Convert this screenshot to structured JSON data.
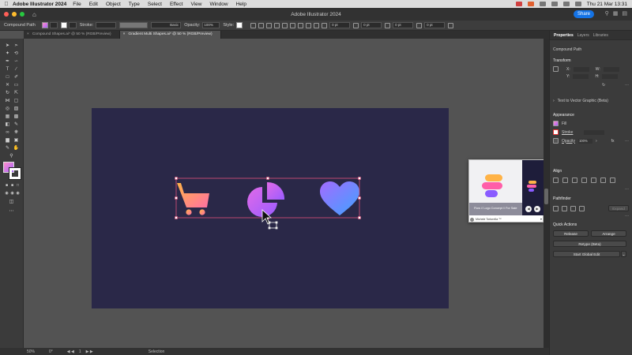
{
  "menubar": {
    "app_name": "Adobe Illustrator 2024",
    "items": [
      "File",
      "Edit",
      "Object",
      "Type",
      "Select",
      "Effect",
      "View",
      "Window",
      "Help"
    ],
    "clock": "Thu 21 Mar  13:31"
  },
  "titlebar": {
    "title": "Adobe Illustrator 2024",
    "share_label": "Share"
  },
  "controlbar": {
    "selection_label": "Compound Path",
    "stroke_label": "Stroke:",
    "brush_label": "Basic",
    "opacity_label": "Opacity:",
    "opacity_value": "100%",
    "style_label": "Style:",
    "field_values": [
      "0 pt",
      "0 pt",
      "0 pt",
      "0 pt"
    ]
  },
  "doc_tabs": [
    {
      "label": "Compound Shapes.ai* @ 50 % (RGB/Preview)",
      "active": false
    },
    {
      "label": "Gradient Multi Shapes.ai* @ 50 % (RGB/Preview)",
      "active": true
    }
  ],
  "status": {
    "zoom": "50%",
    "rotation": "0°",
    "page": "1",
    "mode": "Selection"
  },
  "panel": {
    "tabs": [
      "Properties",
      "Layers",
      "Libraries"
    ],
    "selection": "Compound Path",
    "transform_title": "Transform",
    "w_label": "W:",
    "h_label": "H:",
    "x_label": "X:",
    "y_label": "Y:",
    "text_to_vector": "Text to Vector Graphic (Beta)",
    "appearance_title": "Appearance",
    "fill_label": "Fill",
    "stroke_label": "Stroke",
    "opacity_label": "Opacity",
    "opacity_value": "100%",
    "align_title": "Align",
    "pathfinder_title": "Pathfinder",
    "expand_label": "Expand",
    "quick_actions_title": "Quick Actions",
    "release_label": "Release",
    "arrange_label": "Arrange",
    "retype_label": "Retype (Beta)",
    "global_edit_label": "Start Global Edit"
  },
  "popup": {
    "caption": "Flow // Logo Concept // For Sale",
    "author": "Michele Tortorella ™"
  },
  "colors": {
    "artboard": "#2a2848",
    "accent": "#1473e6",
    "grad_start": "#ff9966",
    "grad_mid": "#c15cf5",
    "grad_end": "#5a8cff"
  },
  "icons": [
    "shopping-cart-icon",
    "pie-chart-icon",
    "heart-icon"
  ]
}
